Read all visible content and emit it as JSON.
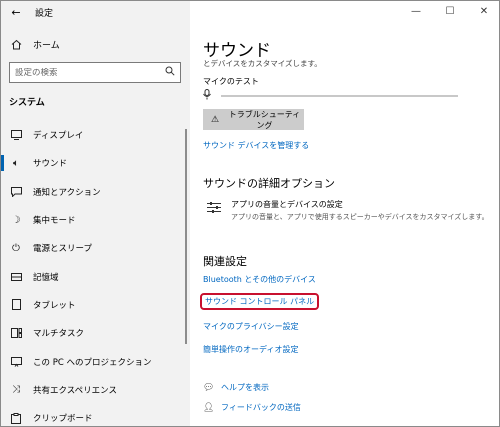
{
  "window": {
    "title": "設定"
  },
  "sidebar": {
    "home_label": "ホーム",
    "search_placeholder": "設定の検索",
    "section": "システム",
    "items": [
      {
        "label": "ディスプレイ",
        "icon": "display-icon"
      },
      {
        "label": "サウンド",
        "icon": "speaker-icon",
        "active": true
      },
      {
        "label": "通知とアクション",
        "icon": "notification-icon"
      },
      {
        "label": "集中モード",
        "icon": "moon-icon"
      },
      {
        "label": "電源とスリープ",
        "icon": "power-icon"
      },
      {
        "label": "記憶域",
        "icon": "storage-icon"
      },
      {
        "label": "タブレット",
        "icon": "tablet-icon"
      },
      {
        "label": "マルチタスク",
        "icon": "multitask-icon"
      },
      {
        "label": "この PC へのプロジェクション",
        "icon": "projection-icon"
      },
      {
        "label": "共有エクスペリエンス",
        "icon": "share-icon"
      },
      {
        "label": "クリップボード",
        "icon": "clipboard-icon"
      }
    ]
  },
  "main": {
    "title": "サウンド",
    "subtitle": "とデバイスをカスタマイズします。",
    "mic_test_label": "マイクのテスト",
    "troubleshoot_label": "トラブルシューティング",
    "manage_devices_link": "サウンド デバイスを管理する",
    "advanced_heading": "サウンドの詳細オプション",
    "app_volume_title": "アプリの音量とデバイスの設定",
    "app_volume_desc": "アプリの音量と、アプリで使用するスピーカーやデバイスをカスタマイズします。",
    "related_heading": "関連設定",
    "related_links": {
      "bluetooth": "Bluetooth とその他のデバイス",
      "sound_control_panel": "サウンド コントロール パネル",
      "mic_privacy": "マイクのプライバシー設定",
      "ease_of_access": "簡単操作のオーディオ設定"
    },
    "help_label": "ヘルプを表示",
    "feedback_label": "フィードバックの送信"
  },
  "colors": {
    "accent": "#0067c0",
    "highlight": "#c8102e",
    "sidebar_bg": "#f2f2f2"
  }
}
